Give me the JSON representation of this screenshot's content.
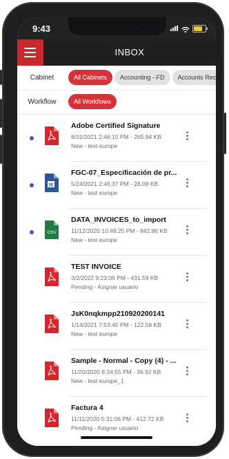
{
  "status": {
    "time": "9:43"
  },
  "header": {
    "title": "INBOX"
  },
  "filters": {
    "cabinet_label": "Cabinet",
    "cabinets": [
      "All Cabinets",
      "Accounting - FD",
      "Accounts Rece"
    ],
    "workflow_label": "Workflow",
    "workflows": [
      "All Workflows"
    ]
  },
  "colors": {
    "accent": "#d3333a",
    "unread_dot": "#6b3fbd",
    "header_bg": "#1f1f1f"
  },
  "items": [
    {
      "title": "Adobe Certified Signature",
      "meta": "8/31/2021 2:46:15 PM - 265.94 KB",
      "status": "New - test europe",
      "icon": "pdf-icon",
      "unread": true
    },
    {
      "title": "FGC-07_Especificación de pr...",
      "meta": "5/24/2021 2:46:37 PM - 28.08 KB",
      "status": "New - test europe",
      "icon": "word-doc-icon",
      "unread": true
    },
    {
      "title": "DATA_INVOICES_to_import",
      "meta": "11/12/2020 10:49:25 PM - 842.86 KB",
      "status": "New - test europe",
      "icon": "csv-icon",
      "unread": true
    },
    {
      "title": "TEST INVOICE",
      "meta": "3/2/2022 9:23:06 PM - 431.59 KB",
      "status": "Pending - Asignar usuario",
      "icon": "pdf-icon",
      "unread": false
    },
    {
      "title": "JsK0nqkmpp210920200141",
      "meta": "1/14/2021 7:53:45 PM - 122.56 KB",
      "status": "New - test europe",
      "icon": "pdf-icon",
      "unread": false
    },
    {
      "title": "Sample - Normal - Copy (4) - ...",
      "meta": "11/20/2020 8:34:55 PM - 36.92 KB",
      "status": "New - test europe_1",
      "icon": "pdf-icon",
      "unread": false
    },
    {
      "title": "Factura 4",
      "meta": "11/11/2020 5:31:06 PM - 412.72 KB",
      "status": "Pending - Asignar usuario",
      "icon": "pdf-icon",
      "unread": false
    }
  ]
}
